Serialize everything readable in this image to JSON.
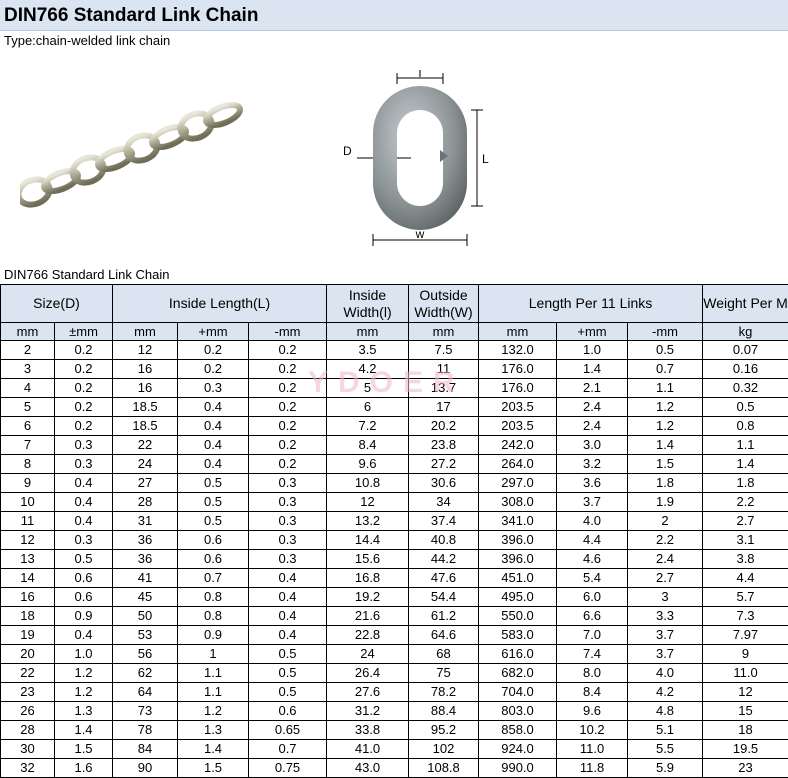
{
  "page": {
    "title": "DIN766 Standard Link Chain",
    "subtitle": "Type:chain-welded link chain",
    "caption": "DIN766 Standard Link Chain",
    "watermark": "YDOER"
  },
  "diagram": {
    "label_l_top": "l",
    "label_d": "D",
    "label_L": "L",
    "label_w": "w"
  },
  "colors": {
    "header_bg": "#dbe5f1",
    "border": "#000000",
    "metal": "#8a9193"
  },
  "table": {
    "group_headers": [
      "Size(D)",
      "Inside Length(L)",
      "Inside Width(l)",
      "Outside Width(W)",
      "Length Per 11 Links",
      "Weight Per M"
    ],
    "sub_headers": [
      "mm",
      "±mm",
      "mm",
      "+mm",
      "-mm",
      "mm",
      "mm",
      "mm",
      "+mm",
      "-mm",
      "kg"
    ],
    "rows": [
      [
        "2",
        "0.2",
        "12",
        "0.2",
        "0.2",
        "3.5",
        "7.5",
        "132.0",
        "1.0",
        "0.5",
        "0.07"
      ],
      [
        "3",
        "0.2",
        "16",
        "0.2",
        "0.2",
        "4.2",
        "11",
        "176.0",
        "1.4",
        "0.7",
        "0.16"
      ],
      [
        "4",
        "0.2",
        "16",
        "0.3",
        "0.2",
        "5",
        "13.7",
        "176.0",
        "2.1",
        "1.1",
        "0.32"
      ],
      [
        "5",
        "0.2",
        "18.5",
        "0.4",
        "0.2",
        "6",
        "17",
        "203.5",
        "2.4",
        "1.2",
        "0.5"
      ],
      [
        "6",
        "0.2",
        "18.5",
        "0.4",
        "0.2",
        "7.2",
        "20.2",
        "203.5",
        "2.4",
        "1.2",
        "0.8"
      ],
      [
        "7",
        "0.3",
        "22",
        "0.4",
        "0.2",
        "8.4",
        "23.8",
        "242.0",
        "3.0",
        "1.4",
        "1.1"
      ],
      [
        "8",
        "0.3",
        "24",
        "0.4",
        "0.2",
        "9.6",
        "27.2",
        "264.0",
        "3.2",
        "1.5",
        "1.4"
      ],
      [
        "9",
        "0.4",
        "27",
        "0.5",
        "0.3",
        "10.8",
        "30.6",
        "297.0",
        "3.6",
        "1.8",
        "1.8"
      ],
      [
        "10",
        "0.4",
        "28",
        "0.5",
        "0.3",
        "12",
        "34",
        "308.0",
        "3.7",
        "1.9",
        "2.2"
      ],
      [
        "11",
        "0.4",
        "31",
        "0.5",
        "0.3",
        "13.2",
        "37.4",
        "341.0",
        "4.0",
        "2",
        "2.7"
      ],
      [
        "12",
        "0.3",
        "36",
        "0.6",
        "0.3",
        "14.4",
        "40.8",
        "396.0",
        "4.4",
        "2.2",
        "3.1"
      ],
      [
        "13",
        "0.5",
        "36",
        "0.6",
        "0.3",
        "15.6",
        "44.2",
        "396.0",
        "4.6",
        "2.4",
        "3.8"
      ],
      [
        "14",
        "0.6",
        "41",
        "0.7",
        "0.4",
        "16.8",
        "47.6",
        "451.0",
        "5.4",
        "2.7",
        "4.4"
      ],
      [
        "16",
        "0.6",
        "45",
        "0.8",
        "0.4",
        "19.2",
        "54.4",
        "495.0",
        "6.0",
        "3",
        "5.7"
      ],
      [
        "18",
        "0.9",
        "50",
        "0.8",
        "0.4",
        "21.6",
        "61.2",
        "550.0",
        "6.6",
        "3.3",
        "7.3"
      ],
      [
        "19",
        "0.4",
        "53",
        "0.9",
        "0.4",
        "22.8",
        "64.6",
        "583.0",
        "7.0",
        "3.7",
        "7.97"
      ],
      [
        "20",
        "1.0",
        "56",
        "1",
        "0.5",
        "24",
        "68",
        "616.0",
        "7.4",
        "3.7",
        "9"
      ],
      [
        "22",
        "1.2",
        "62",
        "1.1",
        "0.5",
        "26.4",
        "75",
        "682.0",
        "8.0",
        "4.0",
        "11.0"
      ],
      [
        "23",
        "1.2",
        "64",
        "1.1",
        "0.5",
        "27.6",
        "78.2",
        "704.0",
        "8.4",
        "4.2",
        "12"
      ],
      [
        "26",
        "1.3",
        "73",
        "1.2",
        "0.6",
        "31.2",
        "88.4",
        "803.0",
        "9.6",
        "4.8",
        "15"
      ],
      [
        "28",
        "1.4",
        "78",
        "1.3",
        "0.65",
        "33.8",
        "95.2",
        "858.0",
        "10.2",
        "5.1",
        "18"
      ],
      [
        "30",
        "1.5",
        "84",
        "1.4",
        "0.7",
        "41.0",
        "102",
        "924.0",
        "11.0",
        "5.5",
        "19.5"
      ],
      [
        "32",
        "1.6",
        "90",
        "1.5",
        "0.75",
        "43.0",
        "108.8",
        "990.0",
        "11.8",
        "5.9",
        "23"
      ]
    ]
  }
}
